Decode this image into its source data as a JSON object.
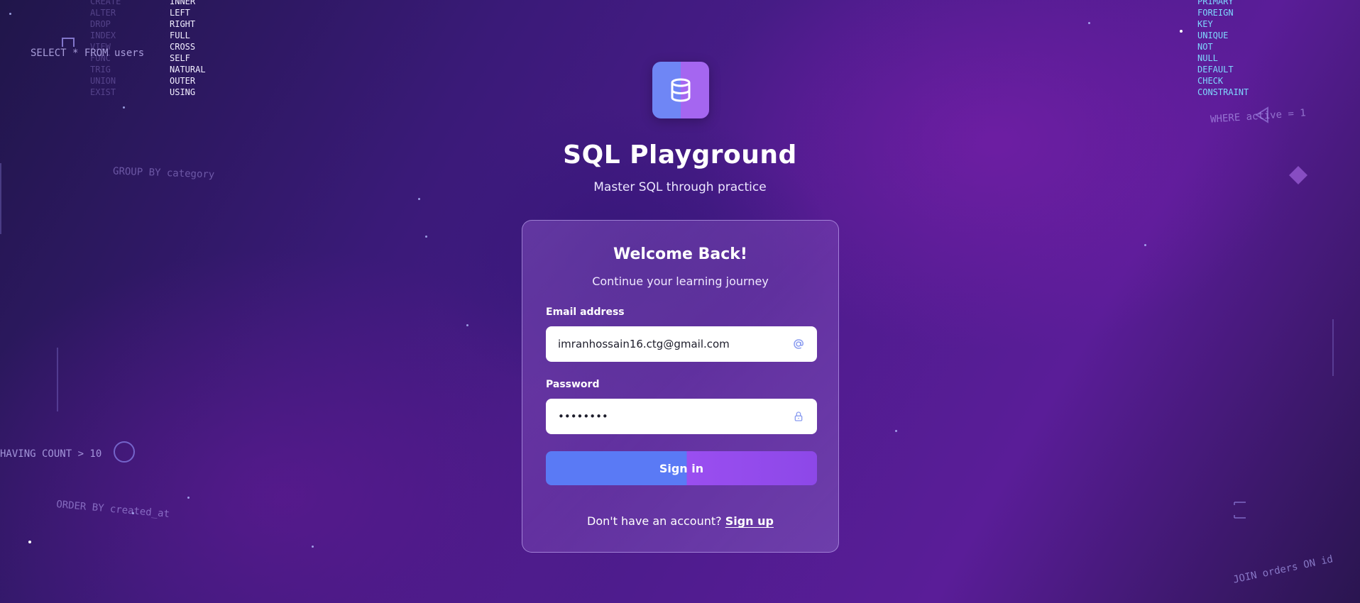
{
  "background": {
    "left_dim_keywords": [
      "CREATE",
      "ALTER",
      "DROP",
      "INDEX",
      "VIEW",
      "FUNC",
      "TRIG",
      "UNION",
      "EXIST"
    ],
    "join_keywords": [
      "INNER",
      "LEFT",
      "RIGHT",
      "FULL",
      "CROSS",
      "SELF",
      "NATURAL",
      "OUTER",
      "USING"
    ],
    "constraint_keywords": [
      "PRIMARY",
      "FOREIGN",
      "KEY",
      "UNIQUE",
      "NOT",
      "NULL",
      "DEFAULT",
      "CHECK",
      "CONSTRAINT"
    ],
    "floating_sql": {
      "select": "SELECT * FROM users",
      "group_by": "GROUP BY category",
      "having": "HAVING COUNT > 10",
      "order_by": "ORDER BY created_at",
      "where": "WHERE active = 1",
      "join": "JOIN orders ON id"
    }
  },
  "app": {
    "logo_icon": "database-icon",
    "title": "SQL Playground",
    "subtitle": "Master SQL through practice"
  },
  "login": {
    "title": "Welcome Back!",
    "subtitle": "Continue your learning journey",
    "email_label": "Email address",
    "email_value": "imranhossain16.ctg@gmail.com",
    "email_icon": "at-sign-icon",
    "password_label": "Password",
    "password_value": "••••••••",
    "password_icon": "lock-icon",
    "submit_label": "Sign in",
    "signup_prompt": "Don't have an account?",
    "signup_link": "Sign up"
  },
  "colors": {
    "button_start": "#5a7af5",
    "button_end": "#8d48e8",
    "logo_left": "#6f86f5",
    "logo_right": "#a566f0"
  }
}
